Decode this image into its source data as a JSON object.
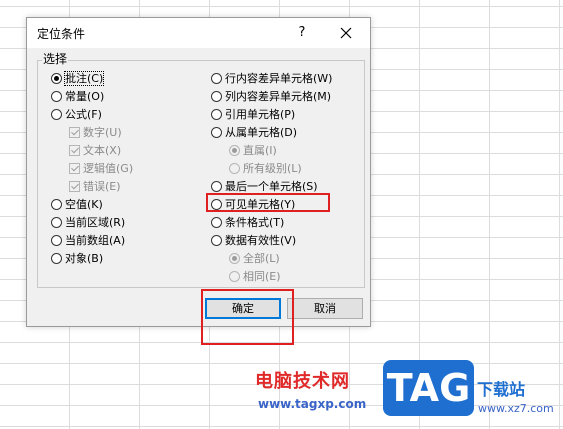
{
  "dialog": {
    "title": "定位条件",
    "help": "?",
    "group_label": "选择",
    "left_options": [
      {
        "label": "批注(C)",
        "kind": "radio",
        "checked": true,
        "disabled": false
      },
      {
        "label": "常量(O)",
        "kind": "radio",
        "checked": false,
        "disabled": false
      },
      {
        "label": "公式(F)",
        "kind": "radio",
        "checked": false,
        "disabled": false
      },
      {
        "label": "数字(U)",
        "kind": "check",
        "checked": true,
        "disabled": true
      },
      {
        "label": "文本(X)",
        "kind": "check",
        "checked": true,
        "disabled": true
      },
      {
        "label": "逻辑值(G)",
        "kind": "check",
        "checked": true,
        "disabled": true
      },
      {
        "label": "错误(E)",
        "kind": "check",
        "checked": true,
        "disabled": true
      },
      {
        "label": "空值(K)",
        "kind": "radio",
        "checked": false,
        "disabled": false
      },
      {
        "label": "当前区域(R)",
        "kind": "radio",
        "checked": false,
        "disabled": false
      },
      {
        "label": "当前数组(A)",
        "kind": "radio",
        "checked": false,
        "disabled": false
      },
      {
        "label": "对象(B)",
        "kind": "radio",
        "checked": false,
        "disabled": false
      }
    ],
    "right_options": [
      {
        "label": "行内容差异单元格(W)",
        "kind": "radio",
        "checked": false,
        "disabled": false
      },
      {
        "label": "列内容差异单元格(M)",
        "kind": "radio",
        "checked": false,
        "disabled": false
      },
      {
        "label": "引用单元格(P)",
        "kind": "radio",
        "checked": false,
        "disabled": false
      },
      {
        "label": "从属单元格(D)",
        "kind": "radio",
        "checked": false,
        "disabled": false
      },
      {
        "label": "直属(I)",
        "kind": "radio",
        "checked": true,
        "disabled": true
      },
      {
        "label": "所有级别(L)",
        "kind": "radio",
        "checked": false,
        "disabled": true
      },
      {
        "label": "最后一个单元格(S)",
        "kind": "radio",
        "checked": false,
        "disabled": false
      },
      {
        "label": "可见单元格(Y)",
        "kind": "radio",
        "checked": false,
        "disabled": false
      },
      {
        "label": "条件格式(T)",
        "kind": "radio",
        "checked": false,
        "disabled": false
      },
      {
        "label": "数据有效性(V)",
        "kind": "radio",
        "checked": false,
        "disabled": false
      },
      {
        "label": "全部(L)",
        "kind": "radio",
        "checked": true,
        "disabled": true
      },
      {
        "label": "相同(E)",
        "kind": "radio",
        "checked": false,
        "disabled": true
      }
    ],
    "ok_label": "确定",
    "cancel_label": "取消"
  },
  "watermark": {
    "site_cn": "电脑技术网",
    "site_url": "www.tagxp.com",
    "logo": "TAG",
    "site2_cn": "下载站",
    "site2_url": "www.xz7.com"
  },
  "colors": {
    "highlight_box": "#e02020",
    "default_button_border": "#0078d7",
    "dialog_bg": "#f0f0f0"
  }
}
